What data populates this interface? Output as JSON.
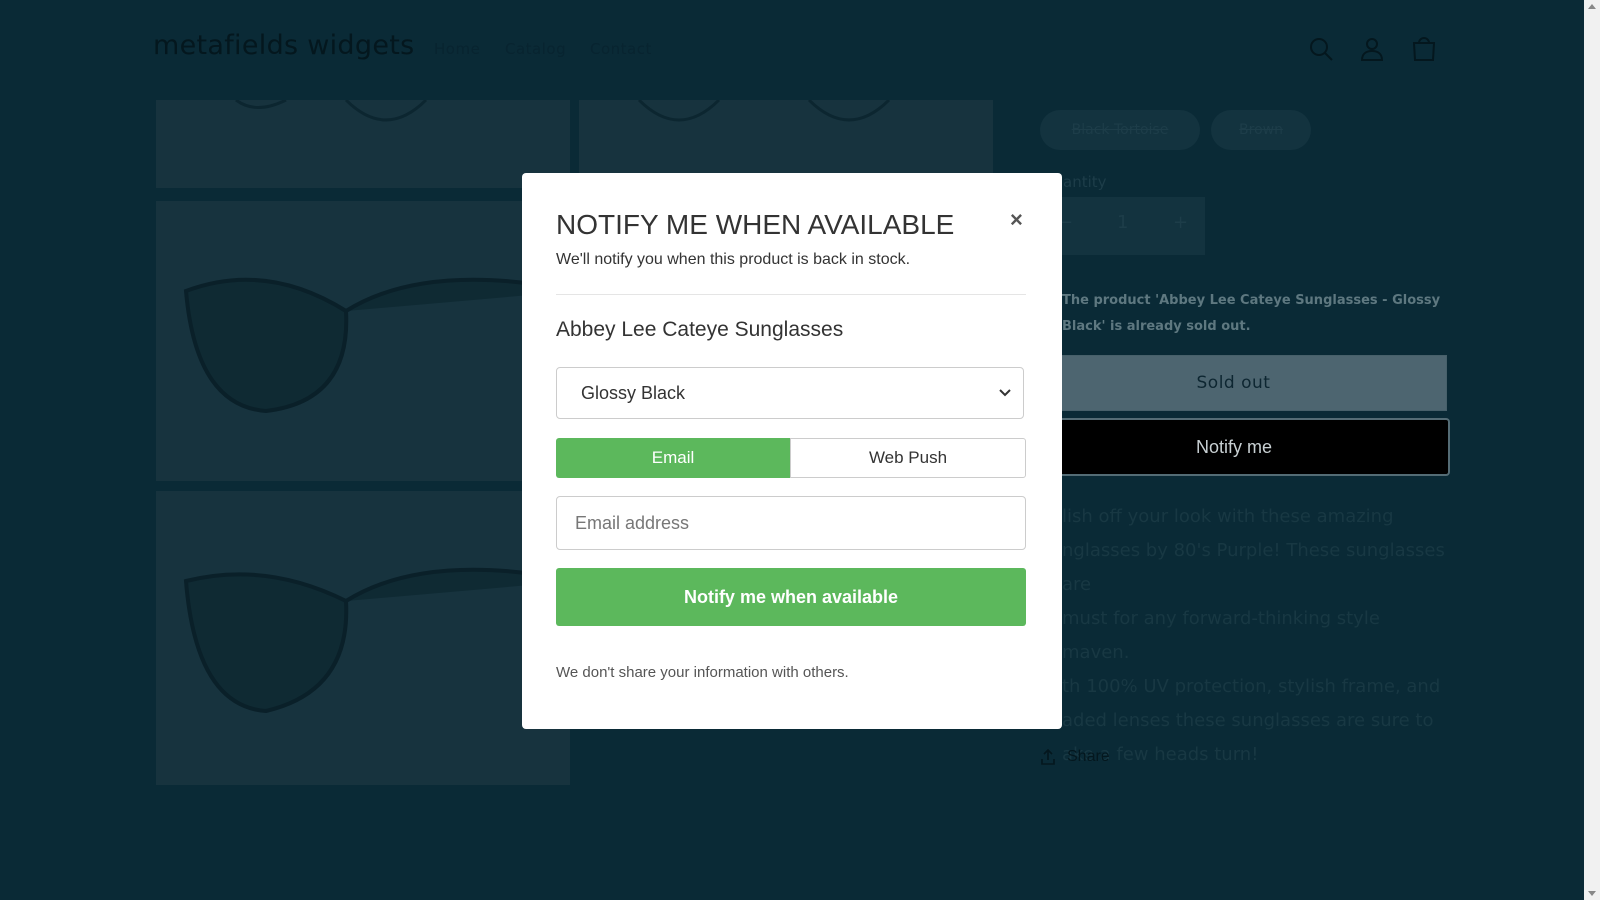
{
  "header": {
    "logo": "metafields widgets",
    "nav": [
      "Home",
      "Catalog",
      "Contact"
    ],
    "icons": [
      "search-icon",
      "account-icon",
      "cart-icon"
    ]
  },
  "product": {
    "variants": [
      "Black Tortoise",
      "Brown"
    ],
    "quantity_label": "antity",
    "quantity": "1",
    "minus": "−",
    "plus": "+",
    "sold_message": "The product 'Abbey Lee Cateye Sunglasses - Glossy Black' is already sold out.",
    "sold_out_label": "Sold out",
    "notify_label": "Notify me",
    "description": [
      "lish off your look with these amazing",
      "nglasses by 80's Purple! These sunglasses are",
      "must for any forward-thinking style maven.",
      "th 100% UV protection, stylish frame, and",
      "aded lenses these sunglasses are sure to",
      "ake a few heads turn!"
    ],
    "share_label": "Share"
  },
  "modal": {
    "title": "NOTIFY ME WHEN AVAILABLE",
    "subtitle": "We'll notify you when this product is back in stock.",
    "close": "×",
    "product_name": "Abbey Lee Cateye Sunglasses",
    "selected_variant": "Glossy Black",
    "tabs": [
      "Email",
      "Web Push"
    ],
    "email_placeholder": "Email address",
    "submit_label": "Notify me when available",
    "footer": "We don't share your information with others.",
    "accent_color": "#5cb85c"
  }
}
